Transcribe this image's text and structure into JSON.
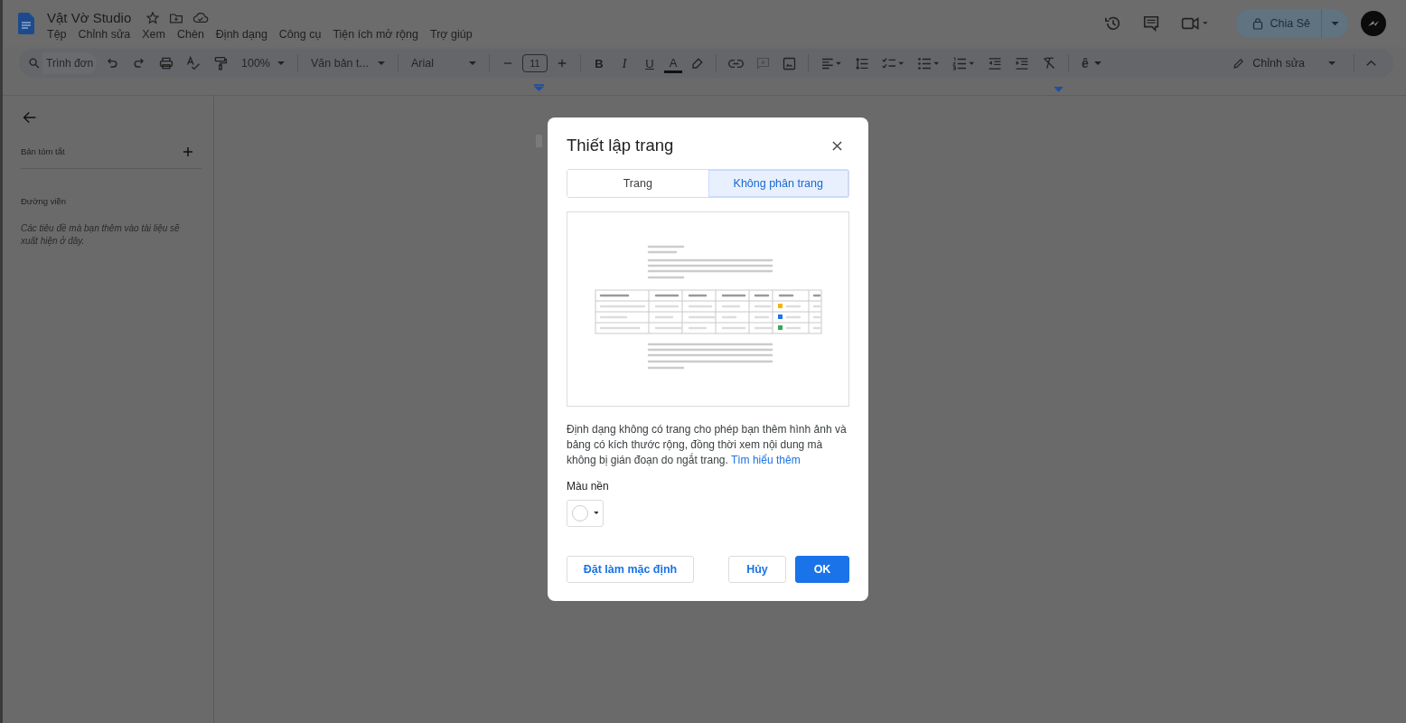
{
  "document": {
    "title": "Vật Vờ Studio"
  },
  "menu": [
    "Tệp",
    "Chỉnh sửa",
    "Xem",
    "Chèn",
    "Định dạng",
    "Công cụ",
    "Tiện ích mở rộng",
    "Trợ giúp"
  ],
  "share_button": {
    "label": "Chia Sẻ"
  },
  "toolbar": {
    "search": {
      "placeholder": "Trình đơn"
    },
    "zoom": "100%",
    "style": "Văn bản t...",
    "font": "Arial",
    "font_size": "11",
    "format_buttons": [
      {
        "kind": "bold",
        "label": "B"
      },
      {
        "kind": "italic",
        "label": "I"
      },
      {
        "kind": "underline",
        "label": "U"
      },
      {
        "kind": "color",
        "label": "A"
      }
    ],
    "input_tools": "ê",
    "mode": "Chỉnh sửa"
  },
  "sidebar": {
    "summary_title": "Bản tóm tắt",
    "outline_title": "Đường viền",
    "outline_hint": "Các tiêu đề mà bạn thêm vào tài liệu sẽ xuất hiện ở đây."
  },
  "dialog": {
    "title": "Thiết lập trang",
    "tabs": [
      {
        "label": "Trang",
        "selected": false
      },
      {
        "label": "Không phân trang",
        "selected": true
      }
    ],
    "description": "Định dạng không có trang cho phép bạn thêm hình ảnh và bảng có kích thước rộng, đồng thời xem nội dung mà không bị gián đoạn do ngắt trang.",
    "link": "Tìm hiểu thêm",
    "background_label": "Màu nền",
    "buttons": [
      {
        "kind": "secondary",
        "label": "Đặt làm mặc định"
      },
      {
        "kind": "secondary",
        "label": "Hủy"
      },
      {
        "kind": "primary",
        "label": "OK"
      }
    ]
  }
}
